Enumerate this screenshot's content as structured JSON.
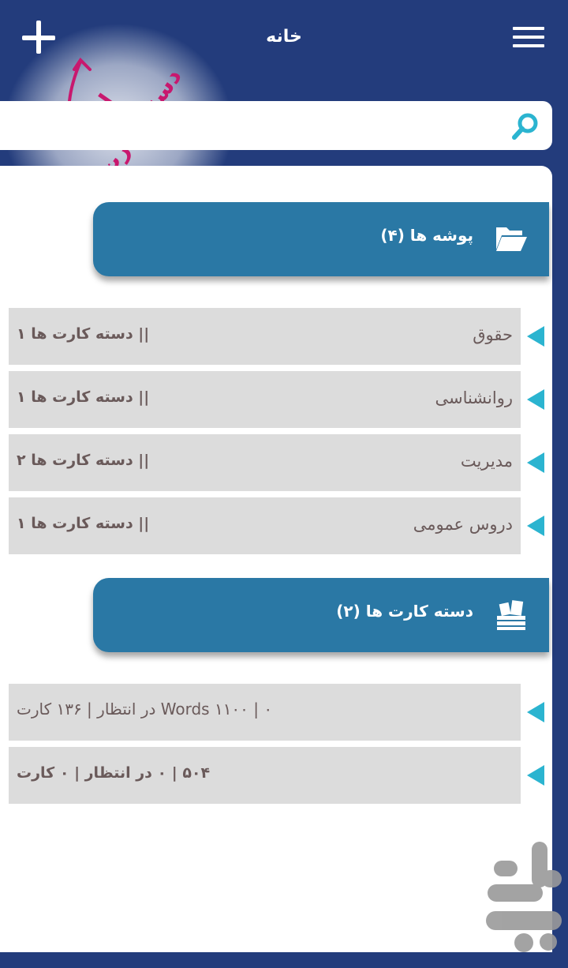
{
  "header": {
    "title": "خانه"
  },
  "annotation": {
    "line1": "ایجاد",
    "line2": "دسته کارت جدید"
  },
  "search": {
    "placeholder": ""
  },
  "folders_section": {
    "label": "پوشه ها (۴)"
  },
  "folders": [
    {
      "name": "حقوق",
      "count": "|| دسته کارت ها ۱"
    },
    {
      "name": "روانشناسی",
      "count": "|| دسته کارت ها ۱"
    },
    {
      "name": "مدیریت",
      "count": "|| دسته کارت ها ۲"
    },
    {
      "name": "دروس عمومی",
      "count": "|| دسته کارت ها ۱"
    }
  ],
  "decks_section": {
    "label": "دسته کارت ها (۲)"
  },
  "decks": [
    {
      "stats": "Words ۱۱۰۰ | ۰ در انتظار | ۱۳۶ کارت"
    },
    {
      "stats": "۵۰۴ | ۰ در انتظار | ۰ کارت"
    }
  ],
  "colors": {
    "header_bg": "#233c7c",
    "section_bg": "#2a78a5",
    "row_bg": "#dcdcdc",
    "accent": "#2bb4d0",
    "annotation": "#c8186e"
  }
}
